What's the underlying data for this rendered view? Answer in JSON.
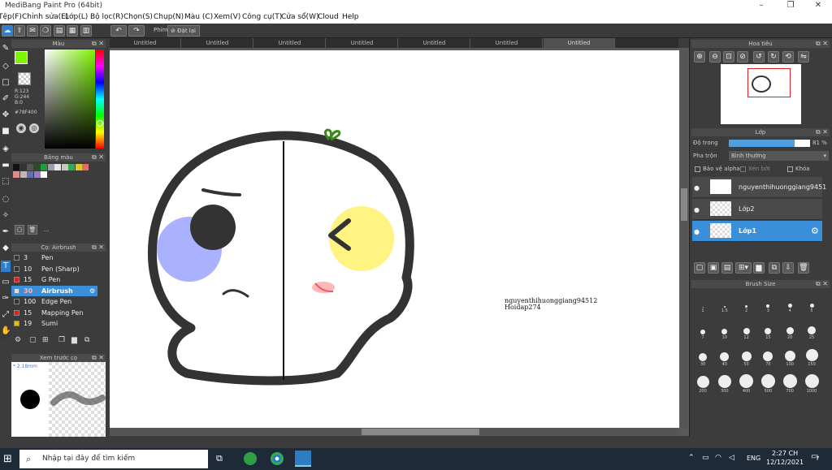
{
  "window": {
    "title": "MediBang Paint Pro (64bit)"
  },
  "menu": [
    "Tệp(F)",
    "Chỉnh sửa(E)",
    "Lớp(L)",
    "Bộ lọc(R)",
    "Chọn(S)",
    "Chụp(N)",
    "Màu (C)",
    "Xem(V)",
    "Công cụ(T)",
    "Cửa sổ(W)",
    "Cloud",
    "Help"
  ],
  "toolbar": {
    "phim_label": "Phím",
    "reset_label": "Đặt lại"
  },
  "color_panel": {
    "title": "Màu",
    "r": "R:123",
    "g": "G:244",
    "b": "B:0",
    "hex": "#78F400",
    "fg_color": "#7bf400"
  },
  "palette_panel": {
    "title": "Bảng màu",
    "swatches": [
      "#111111",
      "#333333",
      "#555555",
      "#2c4a2c",
      "#1e9e3a",
      "#9aa0a6",
      "#e3e7ea",
      "#c7c9b0",
      "#33aa55",
      "#ddcc22",
      "#e86a6a",
      "#e08a8a",
      "#c9b4b4",
      "#6070a8",
      "#9a7cc0",
      "#ffffff"
    ],
    "dots": "..."
  },
  "brush_panel": {
    "title": "Cọ: Airbrush",
    "items": [
      {
        "size": "3",
        "name": "Pen",
        "color": "#333333"
      },
      {
        "size": "10",
        "name": "Pen (Sharp)",
        "color": "#333333"
      },
      {
        "size": "15",
        "name": "G Pen",
        "color": "#e02020"
      },
      {
        "size": "30",
        "name": "Airbrush",
        "color": "#dddddd",
        "selected": true
      },
      {
        "size": "100",
        "name": "Edge Pen",
        "color": "#333333"
      },
      {
        "size": "15",
        "name": "Mapping Pen",
        "color": "#e02020"
      },
      {
        "size": "19",
        "name": "Sumi",
        "color": "#e0c020"
      }
    ]
  },
  "preview_panel": {
    "title": "Xem trước cọ",
    "size_label": "* 2.18mm"
  },
  "tabs": [
    "Untitled",
    "Untitled",
    "Untitled",
    "Untitled",
    "Untitled",
    "Untitled",
    "Untitled"
  ],
  "canvas": {
    "watermark_line1": "nguyenthihuonggiang94512",
    "watermark_line2": "Hoidap274"
  },
  "navigator": {
    "title": "Hoa tiêu"
  },
  "layer_panel": {
    "title": "Lớp",
    "opacity_label": "Độ trong",
    "opacity_value": "81 %",
    "opacity_pct": 81,
    "blend_label": "Pha trộn",
    "blend_value": "Bình thường",
    "protect_alpha": "Bảo vệ alpha",
    "clip": "Xén bớt",
    "lock": "Khóa",
    "layers": [
      {
        "name": "nguyenthihuonggiang9451"
      },
      {
        "name": "Lớp2"
      },
      {
        "name": "Lớp1",
        "selected": true
      }
    ]
  },
  "brush_size_panel": {
    "title": "Brush Size",
    "sizes": [
      "1",
      "1.5",
      "2",
      "3",
      "4",
      "5",
      "7",
      "10",
      "12",
      "15",
      "20",
      "25",
      "30",
      "40",
      "50",
      "70",
      "100",
      "150",
      "200",
      "300",
      "400",
      "500",
      "700",
      "1000"
    ]
  },
  "taskbar": {
    "search_placeholder": "Nhập tại đây để tìm kiếm",
    "lang": "ENG",
    "time": "2:27 CH",
    "date": "12/12/2021",
    "notif_count": "7"
  }
}
